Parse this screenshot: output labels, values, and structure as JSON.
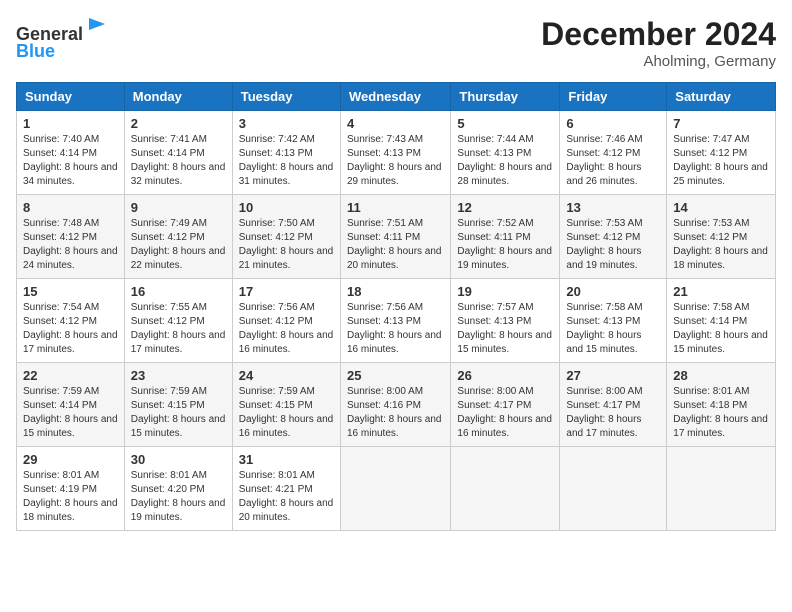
{
  "header": {
    "logo_line1": "General",
    "logo_line2": "Blue",
    "month": "December 2024",
    "location": "Aholming, Germany"
  },
  "weekdays": [
    "Sunday",
    "Monday",
    "Tuesday",
    "Wednesday",
    "Thursday",
    "Friday",
    "Saturday"
  ],
  "weeks": [
    [
      {
        "day": "1",
        "sunrise": "7:40 AM",
        "sunset": "4:14 PM",
        "daylight": "8 hours and 34 minutes."
      },
      {
        "day": "2",
        "sunrise": "7:41 AM",
        "sunset": "4:14 PM",
        "daylight": "8 hours and 32 minutes."
      },
      {
        "day": "3",
        "sunrise": "7:42 AM",
        "sunset": "4:13 PM",
        "daylight": "8 hours and 31 minutes."
      },
      {
        "day": "4",
        "sunrise": "7:43 AM",
        "sunset": "4:13 PM",
        "daylight": "8 hours and 29 minutes."
      },
      {
        "day": "5",
        "sunrise": "7:44 AM",
        "sunset": "4:13 PM",
        "daylight": "8 hours and 28 minutes."
      },
      {
        "day": "6",
        "sunrise": "7:46 AM",
        "sunset": "4:12 PM",
        "daylight": "8 hours and 26 minutes."
      },
      {
        "day": "7",
        "sunrise": "7:47 AM",
        "sunset": "4:12 PM",
        "daylight": "8 hours and 25 minutes."
      }
    ],
    [
      {
        "day": "8",
        "sunrise": "7:48 AM",
        "sunset": "4:12 PM",
        "daylight": "8 hours and 24 minutes."
      },
      {
        "day": "9",
        "sunrise": "7:49 AM",
        "sunset": "4:12 PM",
        "daylight": "8 hours and 22 minutes."
      },
      {
        "day": "10",
        "sunrise": "7:50 AM",
        "sunset": "4:12 PM",
        "daylight": "8 hours and 21 minutes."
      },
      {
        "day": "11",
        "sunrise": "7:51 AM",
        "sunset": "4:11 PM",
        "daylight": "8 hours and 20 minutes."
      },
      {
        "day": "12",
        "sunrise": "7:52 AM",
        "sunset": "4:11 PM",
        "daylight": "8 hours and 19 minutes."
      },
      {
        "day": "13",
        "sunrise": "7:53 AM",
        "sunset": "4:12 PM",
        "daylight": "8 hours and 19 minutes."
      },
      {
        "day": "14",
        "sunrise": "7:53 AM",
        "sunset": "4:12 PM",
        "daylight": "8 hours and 18 minutes."
      }
    ],
    [
      {
        "day": "15",
        "sunrise": "7:54 AM",
        "sunset": "4:12 PM",
        "daylight": "8 hours and 17 minutes."
      },
      {
        "day": "16",
        "sunrise": "7:55 AM",
        "sunset": "4:12 PM",
        "daylight": "8 hours and 17 minutes."
      },
      {
        "day": "17",
        "sunrise": "7:56 AM",
        "sunset": "4:12 PM",
        "daylight": "8 hours and 16 minutes."
      },
      {
        "day": "18",
        "sunrise": "7:56 AM",
        "sunset": "4:13 PM",
        "daylight": "8 hours and 16 minutes."
      },
      {
        "day": "19",
        "sunrise": "7:57 AM",
        "sunset": "4:13 PM",
        "daylight": "8 hours and 15 minutes."
      },
      {
        "day": "20",
        "sunrise": "7:58 AM",
        "sunset": "4:13 PM",
        "daylight": "8 hours and 15 minutes."
      },
      {
        "day": "21",
        "sunrise": "7:58 AM",
        "sunset": "4:14 PM",
        "daylight": "8 hours and 15 minutes."
      }
    ],
    [
      {
        "day": "22",
        "sunrise": "7:59 AM",
        "sunset": "4:14 PM",
        "daylight": "8 hours and 15 minutes."
      },
      {
        "day": "23",
        "sunrise": "7:59 AM",
        "sunset": "4:15 PM",
        "daylight": "8 hours and 15 minutes."
      },
      {
        "day": "24",
        "sunrise": "7:59 AM",
        "sunset": "4:15 PM",
        "daylight": "8 hours and 16 minutes."
      },
      {
        "day": "25",
        "sunrise": "8:00 AM",
        "sunset": "4:16 PM",
        "daylight": "8 hours and 16 minutes."
      },
      {
        "day": "26",
        "sunrise": "8:00 AM",
        "sunset": "4:17 PM",
        "daylight": "8 hours and 16 minutes."
      },
      {
        "day": "27",
        "sunrise": "8:00 AM",
        "sunset": "4:17 PM",
        "daylight": "8 hours and 17 minutes."
      },
      {
        "day": "28",
        "sunrise": "8:01 AM",
        "sunset": "4:18 PM",
        "daylight": "8 hours and 17 minutes."
      }
    ],
    [
      {
        "day": "29",
        "sunrise": "8:01 AM",
        "sunset": "4:19 PM",
        "daylight": "8 hours and 18 minutes."
      },
      {
        "day": "30",
        "sunrise": "8:01 AM",
        "sunset": "4:20 PM",
        "daylight": "8 hours and 19 minutes."
      },
      {
        "day": "31",
        "sunrise": "8:01 AM",
        "sunset": "4:21 PM",
        "daylight": "8 hours and 20 minutes."
      },
      null,
      null,
      null,
      null
    ]
  ],
  "labels": {
    "sunrise": "Sunrise:",
    "sunset": "Sunset:",
    "daylight": "Daylight:"
  }
}
